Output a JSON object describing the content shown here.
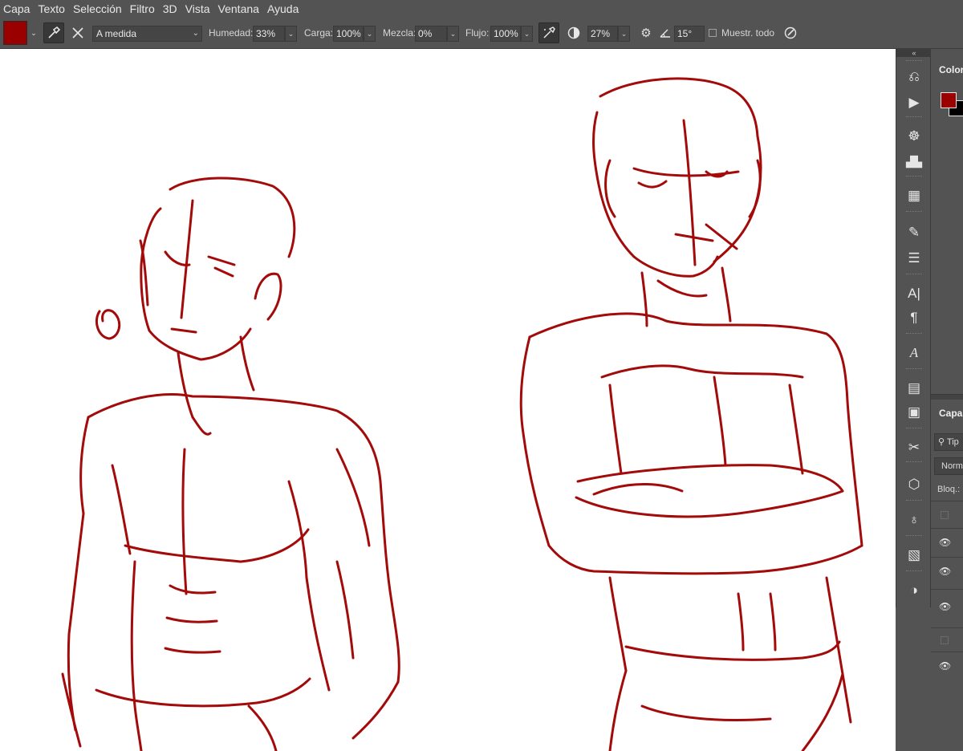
{
  "menu": {
    "items": [
      "Capa",
      "Texto",
      "Selección",
      "Filtro",
      "3D",
      "Vista",
      "Ventana",
      "Ayuda"
    ]
  },
  "options": {
    "brush_color": "#9b0000",
    "preset": "A medida",
    "humedad_label": "Humedad:",
    "humedad_value": "33%",
    "carga_label": "Carga:",
    "carga_value": "100%",
    "mezcla_label": "Mezcla:",
    "mezcla_value": "0%",
    "flujo_label": "Flujo:",
    "flujo_value": "100%",
    "pressure_value": "27%",
    "angle_value": "15°",
    "sample_all_label": "Muestr. todo"
  },
  "panels": {
    "color_title": "Color",
    "layers_title": "Capas",
    "search_placeholder": "Tip",
    "blend_mode": "Norm",
    "lock_label": "Bloq.:",
    "foreground": "#9b0000",
    "background": "#000000"
  },
  "icons": {
    "toolstrip": [
      "history-icon",
      "play-actions-icon",
      "navigator-icon",
      "histogram-icon",
      "properties-icon",
      "brush-settings-icon",
      "adjustments-icon",
      "character-icon",
      "paragraph-icon",
      "glyphs-icon",
      "notes-icon",
      "info-icon",
      "tools-icon",
      "3d-icon",
      "learn-icon",
      "libraries-icon",
      "adjustment-layer-icon"
    ]
  }
}
